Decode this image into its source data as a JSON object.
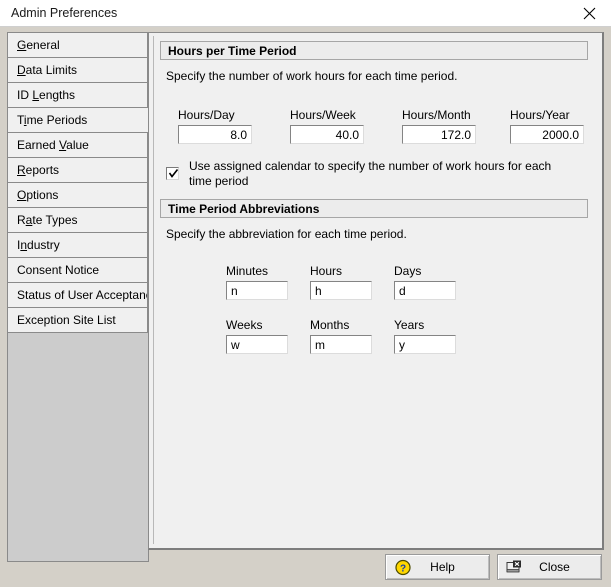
{
  "window": {
    "title": "Admin Preferences",
    "close_icon": "close-x-icon"
  },
  "sidebar": {
    "items": [
      {
        "label": "General",
        "accel": "G",
        "selected": false
      },
      {
        "label": "Data Limits",
        "accel": "D",
        "selected": false
      },
      {
        "label": "ID Lengths",
        "accel": "L",
        "selected": false
      },
      {
        "label": "Time Periods",
        "accel": "i",
        "selected": true
      },
      {
        "label": "Earned Value",
        "accel": "V",
        "selected": false
      },
      {
        "label": "Reports",
        "accel": "R",
        "selected": false
      },
      {
        "label": "Options",
        "accel": "O",
        "selected": false
      },
      {
        "label": "Rate Types",
        "accel": "a",
        "selected": false
      },
      {
        "label": "Industry",
        "accel": "n",
        "selected": false
      },
      {
        "label": "Consent Notice",
        "accel": "",
        "selected": false
      },
      {
        "label": "Status of User Acceptance",
        "accel": "",
        "selected": false
      },
      {
        "label": "Exception Site List",
        "accel": "",
        "selected": false
      }
    ]
  },
  "main": {
    "hours_section": {
      "header": "Hours per Time Period",
      "description": "Specify the number of work hours for each time period.",
      "fields": [
        {
          "label": "Hours/Day",
          "value": "8.0"
        },
        {
          "label": "Hours/Week",
          "value": "40.0"
        },
        {
          "label": "Hours/Month",
          "value": "172.0"
        },
        {
          "label": "Hours/Year",
          "value": "2000.0"
        }
      ],
      "checkbox": {
        "label": "Use assigned calendar to specify the number of work hours for each time period",
        "checked": true
      }
    },
    "abbrev_section": {
      "header": "Time Period Abbreviations",
      "description": "Specify the abbreviation for each time period.",
      "fields": [
        {
          "label": "Minutes",
          "value": "n"
        },
        {
          "label": "Hours",
          "value": "h"
        },
        {
          "label": "Days",
          "value": "d"
        },
        {
          "label": "Weeks",
          "value": "w"
        },
        {
          "label": "Months",
          "value": "m"
        },
        {
          "label": "Years",
          "value": "y"
        }
      ]
    }
  },
  "footer": {
    "help_label": "Help",
    "help_icon": "question-mark-icon",
    "close_label": "Close",
    "close_icon": "close-window-icon"
  },
  "colors": {
    "window_bg": "#d4d0c8",
    "panel_bg": "#f0f0f0",
    "border": "#8a8a8a",
    "help_icon_yellow": "#ffd700",
    "help_icon_blue": "#1a3fa8"
  }
}
